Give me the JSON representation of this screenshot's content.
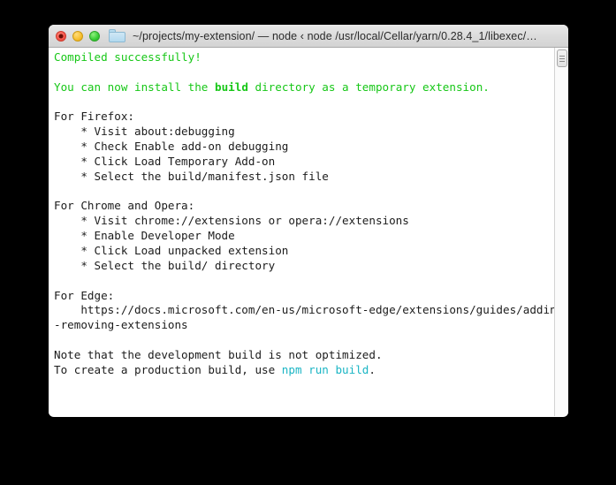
{
  "window": {
    "title": "~/projects/my-extension/  — node ‹ node /usr/local/Cellar/yarn/0.28.4_1/libexec/…",
    "controls": {
      "close_label": "close",
      "minimize_label": "minimize",
      "zoom_label": "zoom"
    },
    "folder_icon": "folder-icon"
  },
  "colors": {
    "success_green": "#17c717",
    "command_cyan": "#1ab5c4",
    "text_black": "#1c1c1c",
    "background": "#ffffff",
    "cursor_gray": "#9a9a9a"
  },
  "terminal": {
    "lines": [
      {
        "id": "l01",
        "text": "Compiled successfully!",
        "style": "green"
      },
      {
        "id": "l02",
        "text": "",
        "style": "blank"
      },
      {
        "id": "l03",
        "segments": [
          {
            "text": "You can now install the ",
            "style": "green"
          },
          {
            "text": "build",
            "style": "green-b"
          },
          {
            "text": " directory as a temporary extension.",
            "style": "green"
          }
        ]
      },
      {
        "id": "l04",
        "text": "",
        "style": "blank"
      },
      {
        "id": "l05",
        "text": "For Firefox:",
        "style": "plain"
      },
      {
        "id": "l06",
        "text": "    * Visit about:debugging",
        "style": "plain"
      },
      {
        "id": "l07",
        "text": "    * Check Enable add-on debugging",
        "style": "plain"
      },
      {
        "id": "l08",
        "text": "    * Click Load Temporary Add-on",
        "style": "plain"
      },
      {
        "id": "l09",
        "text": "    * Select the build/manifest.json file",
        "style": "plain"
      },
      {
        "id": "l10",
        "text": "",
        "style": "blank"
      },
      {
        "id": "l11",
        "text": "For Chrome and Opera:",
        "style": "plain"
      },
      {
        "id": "l12",
        "text": "    * Visit chrome://extensions or opera://extensions",
        "style": "plain"
      },
      {
        "id": "l13",
        "text": "    * Enable Developer Mode",
        "style": "plain"
      },
      {
        "id": "l14",
        "text": "    * Click Load unpacked extension",
        "style": "plain"
      },
      {
        "id": "l15",
        "text": "    * Select the build/ directory",
        "style": "plain"
      },
      {
        "id": "l16",
        "text": "",
        "style": "blank"
      },
      {
        "id": "l17",
        "text": "For Edge:",
        "style": "plain"
      },
      {
        "id": "l18",
        "text": "    https://docs.microsoft.com/en-us/microsoft-edge/extensions/guides/adding-and",
        "style": "plain"
      },
      {
        "id": "l19",
        "text": "-removing-extensions",
        "style": "plain"
      },
      {
        "id": "l20",
        "text": "",
        "style": "blank"
      },
      {
        "id": "l21",
        "text": "Note that the development build is not optimized.",
        "style": "plain"
      },
      {
        "id": "l22",
        "segments": [
          {
            "text": "To create a production build, use ",
            "style": "plain"
          },
          {
            "text": "npm run build",
            "style": "cyan"
          },
          {
            "text": ".",
            "style": "plain"
          }
        ]
      }
    ],
    "cursor": "▌"
  },
  "scrollbar": {
    "thumb_position": "top"
  }
}
